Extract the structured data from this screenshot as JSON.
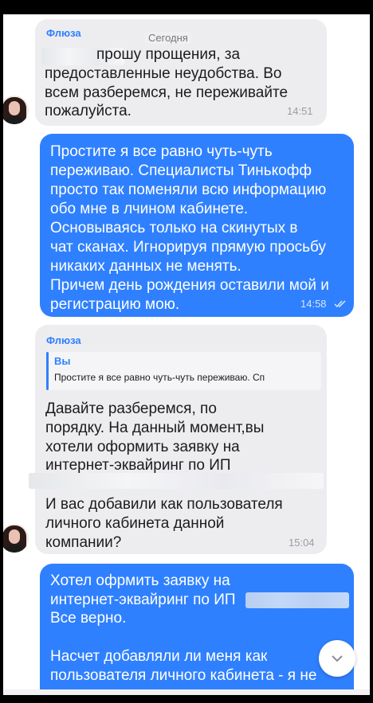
{
  "date_separator": "Сегодня",
  "messages": [
    {
      "sender": "Флюза",
      "lines": [
        "прошу прощения, за",
        "предоставленные неудобства. Во",
        "всем разберемся, не переживайте",
        "пожалуйста."
      ],
      "time": "14:51"
    },
    {
      "lines": [
        "Простите я все равно чуть-чуть",
        "переживаю. Специалисты Тинькофф",
        "просто так поменяли всю информацию",
        "обо мне в лчином кабинете.",
        "Основываясь только на скинутых в",
        "чат сканах. Игнорируя прямую просьбу",
        "никаких данных не менять.",
        "Причем день рождения оставили мой и",
        "регистрацию мою."
      ],
      "time": "14:58",
      "status": "read"
    },
    {
      "sender": "Флюза",
      "reply": {
        "author": "Вы",
        "text": "Простите я все равно чуть-чуть переживаю. Сп"
      },
      "lines": [
        "Давайте разберемся, по",
        "порядку. На данный момент,вы",
        "хотели оформить заявку на",
        "интернет-эквайринг по ИП"
      ],
      "lines2": [
        "И вас добавили как пользователя",
        "личного кабинета данной",
        "компании?"
      ],
      "time": "15:04"
    },
    {
      "lines": [
        "Хотел офрмить заявку на",
        "интернет-эквайринг по ИП",
        "Все верно.",
        "",
        "Насчет добавляли ли меня как",
        "пользователя личного кабинета - я не"
      ]
    }
  ],
  "icons": {
    "read_status": "double-check-icon",
    "scroll_down": "chevron-down-icon"
  },
  "colors": {
    "accent": "#2f80ff",
    "incoming_bg": "#ededf0",
    "outgoing_bg": "#2f80ff"
  }
}
